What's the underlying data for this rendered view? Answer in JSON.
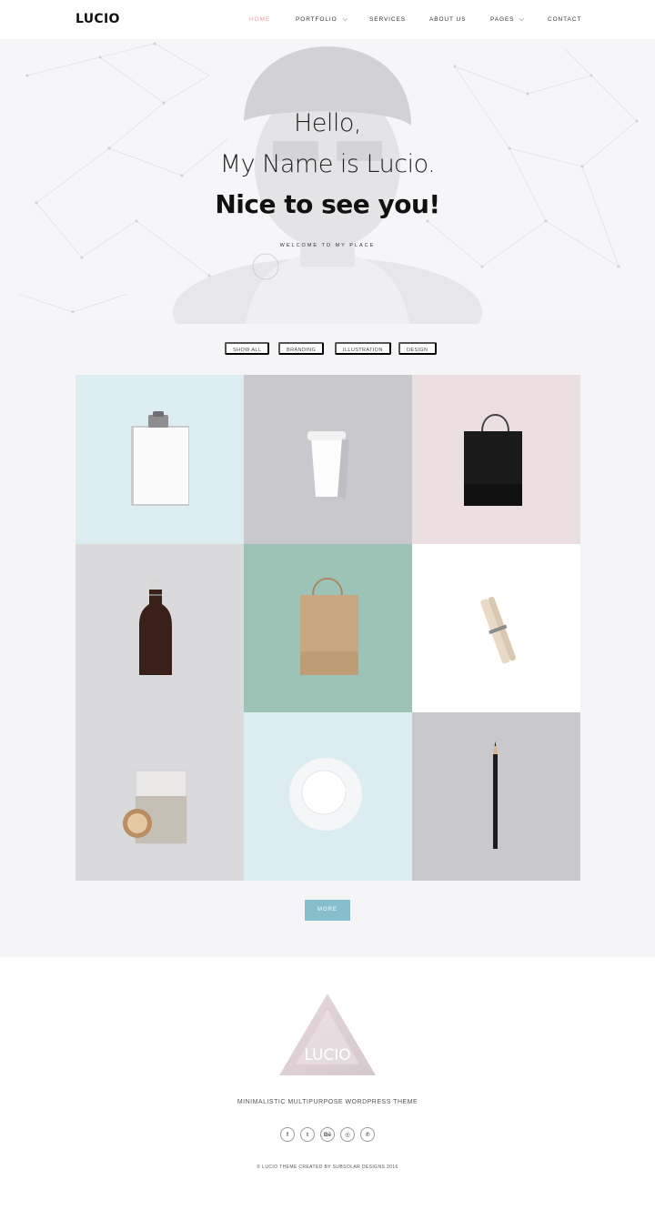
{
  "header": {
    "logo": "LUCIO",
    "nav": [
      {
        "label": "HOME",
        "active": true,
        "dropdown": false
      },
      {
        "label": "PORTFOLIO",
        "active": false,
        "dropdown": true
      },
      {
        "label": "SERVICES",
        "active": false,
        "dropdown": false
      },
      {
        "label": "ABOUT US",
        "active": false,
        "dropdown": false
      },
      {
        "label": "PAGES",
        "active": false,
        "dropdown": true
      },
      {
        "label": "CONTACT",
        "active": false,
        "dropdown": false
      }
    ]
  },
  "hero": {
    "line1": "Hello,",
    "line2": "My Name is Lucio.",
    "line3": "Nice to see you!",
    "subtitle": "WELCOME TO MY PLACE"
  },
  "portfolio": {
    "filters": [
      "SHOW ALL",
      "BRANDING",
      "ILLUSTRATION",
      "DESIGN"
    ],
    "items": [
      {
        "name": "clipboard",
        "bg": "#dcedf1"
      },
      {
        "name": "coffee-cup",
        "bg": "#c9c8cd"
      },
      {
        "name": "black-bag",
        "bg": "#ecdfe2"
      },
      {
        "name": "bottle",
        "bg": "#dadadc"
      },
      {
        "name": "kraft-bag",
        "bg": "#9cc3b5"
      },
      {
        "name": "clothespin",
        "bg": "#ffffff"
      },
      {
        "name": "glass-jar",
        "bg": "#dadadc"
      },
      {
        "name": "cup-saucer",
        "bg": "#dcedf1"
      },
      {
        "name": "pencil",
        "bg": "#c9c8cd"
      }
    ],
    "more_label": "MORE",
    "accent": "#86bfcb"
  },
  "footer": {
    "logo_text": "LUCIO",
    "tagline": "MINIMALISTIC MULTIPURPOSE WORDPRESS THEME",
    "socials": [
      {
        "icon": "facebook-icon",
        "glyph": "f"
      },
      {
        "icon": "twitter-icon",
        "glyph": "t"
      },
      {
        "icon": "behance-icon",
        "glyph": "Bē"
      },
      {
        "icon": "instagram-icon",
        "glyph": "◎"
      },
      {
        "icon": "pinterest-icon",
        "glyph": "℗"
      }
    ],
    "copyright": "© LUCIO THEME CREATED BY SUBSOLAR DESIGNS 2016"
  },
  "colors": {
    "nav_active": "#e9a4a9",
    "hero_bg": "#f6f6f8",
    "portfolio_bg": "#f5f5f8"
  }
}
